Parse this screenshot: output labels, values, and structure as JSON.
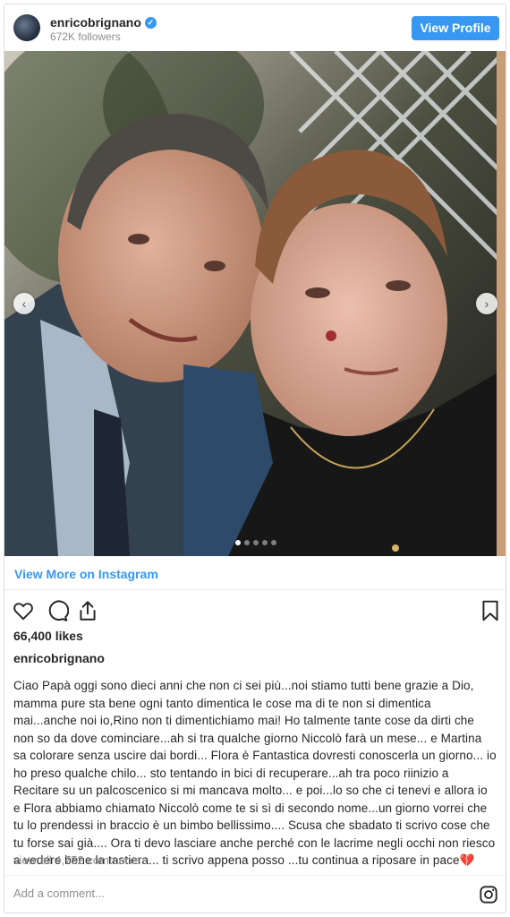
{
  "header": {
    "username": "enricobrignano",
    "verified_mark": "✓",
    "followers": "672K followers",
    "view_profile_label": "View Profile"
  },
  "photo": {
    "nav_prev": "‹",
    "nav_next": "›",
    "slide_count": 5,
    "active_slide": 1
  },
  "view_more_label": "View More on Instagram",
  "actions": {
    "icons": [
      "heart-icon",
      "comment-icon",
      "share-icon",
      "bookmark-icon"
    ]
  },
  "likes": "66,400 likes",
  "author": "enricobrignano",
  "caption": "Ciao Papà oggi sono dieci anni che non ci sei più...noi stiamo tutti bene grazie a Dio, mamma pure sta bene ogni tanto dimentica le cose ma di te non si dimentica mai...anche noi io,Rino non ti dimentichiamo mai! Ho talmente tante cose da dirti che non so da dove cominciare...ah si tra qualche giorno Niccolò farà un mese... e Martina sa colorare senza uscire dai bordi... Flora è Fantastica dovresti conoscerla un giorno... io ho preso qualche chilo... sto tentando in bici di recuperare...ah tra poco riinizio a Recitare su un palcoscenico si mi mancava molto... e poi...lo so che ci tenevi e allora io e Flora abbiamo chiamato Niccolò come te si sì di secondo nome...un giorno vorrei che tu lo prendessi in braccio è un bimbo bellissimo.... Scusa che sbadato ti scrivo cose che tu forse sai già.... Ora ti devo lasciare anche perché con le lacrime negli occhi non riesco a vedere bene la tastiera... ti scrivo appena posso ...tu continua a riposare in pace💔",
  "comments_link": "view all 4,752 comments",
  "add_comment_placeholder": "Add a comment...",
  "colors": {
    "accent": "#3897f0",
    "text": "#262626",
    "muted": "#8e8e8e",
    "border": "#dbdbdb"
  }
}
